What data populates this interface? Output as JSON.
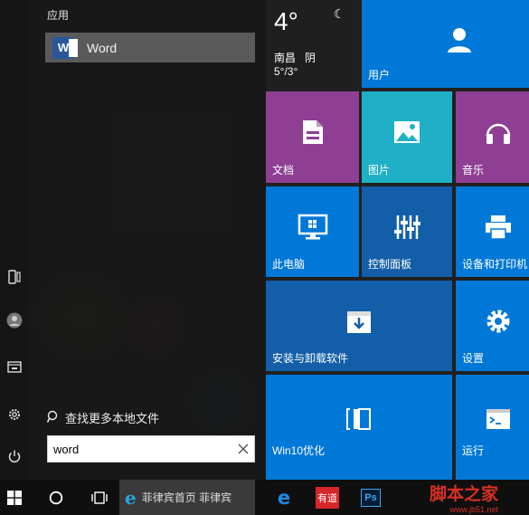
{
  "start_menu": {
    "section_header": "应用",
    "best_match": {
      "label": "Word",
      "icon": "word-icon"
    },
    "more_local": {
      "label": "查找更多本地文件",
      "icon": "search-icon"
    },
    "search": {
      "value": "word",
      "clear_icon": "close-icon"
    }
  },
  "rail": [
    {
      "name": "tablet-mode-icon"
    },
    {
      "name": "user-avatar-icon"
    },
    {
      "name": "file-explorer-icon"
    },
    {
      "name": "gear-icon"
    },
    {
      "name": "power-icon"
    }
  ],
  "weather": {
    "temperature": "4°",
    "city": "南昌",
    "condition": "阴",
    "range": "5°/3°"
  },
  "tiles": {
    "user": {
      "label": "用户"
    },
    "documents": {
      "label": "文档"
    },
    "pictures": {
      "label": "图片"
    },
    "music": {
      "label": "音乐"
    },
    "this_pc": {
      "label": "此电脑"
    },
    "control_panel": {
      "label": "控制面板"
    },
    "devices_printers": {
      "label": "设备和打印机"
    },
    "install_uninstall": {
      "label": "安装与卸载软件"
    },
    "settings": {
      "label": "设置"
    },
    "win10_optimize": {
      "label": "Win10优化"
    },
    "run": {
      "label": "运行"
    }
  },
  "taskbar": {
    "ie_title": "菲律宾首页 菲律宾",
    "app_youdao": "有道",
    "watermark": "脚本之家",
    "watermark_url": "www.jb51.net"
  },
  "colors": {
    "tile_blue": "#0078d7",
    "tile_purple": "#8e3f93",
    "tile_teal": "#1fb0c7",
    "tile_darkblue": "#135ea8",
    "word_blue": "#2b579a"
  }
}
